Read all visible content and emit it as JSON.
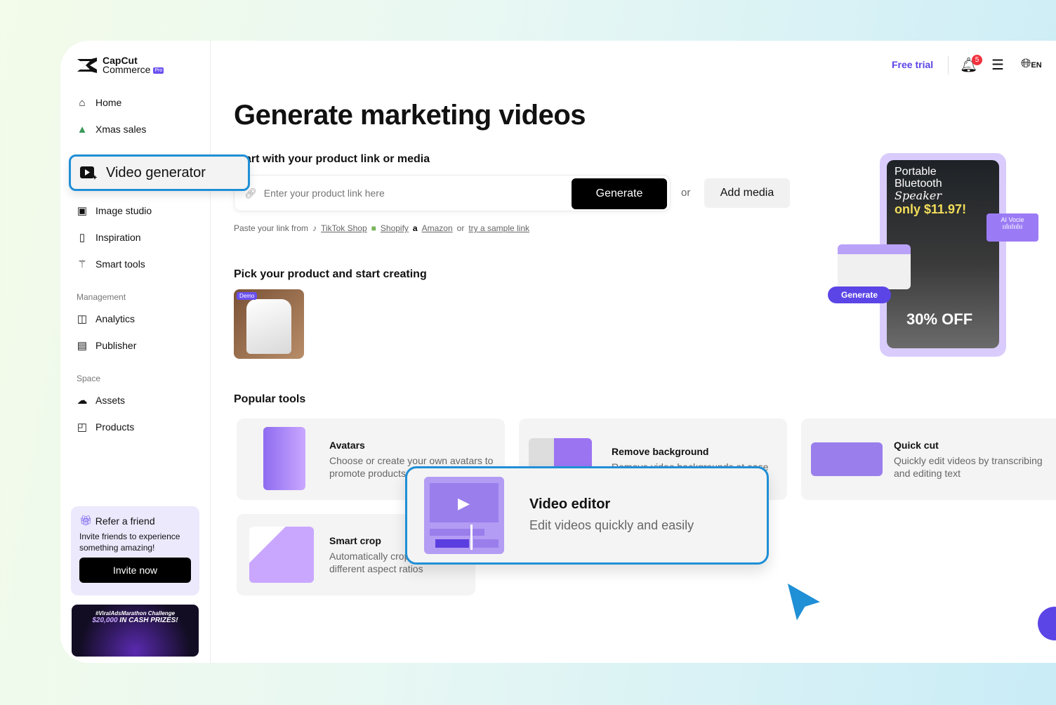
{
  "brand": {
    "name": "CapCut",
    "sub": "Commerce",
    "badge": "Pro"
  },
  "sidebar": {
    "items": [
      {
        "label": "Home",
        "icon": "home-icon"
      },
      {
        "label": "Xmas sales",
        "icon": "tree-icon"
      },
      {
        "label": "Video generator",
        "icon": "video-plus-icon",
        "active": true
      },
      {
        "label": "Image studio",
        "icon": "image-icon"
      },
      {
        "label": "Inspiration",
        "icon": "inspiration-icon"
      },
      {
        "label": "Smart tools",
        "icon": "magic-wand-icon"
      }
    ],
    "management_label": "Management",
    "management": [
      {
        "label": "Analytics"
      },
      {
        "label": "Publisher"
      }
    ],
    "space_label": "Space",
    "space": [
      {
        "label": "Assets"
      },
      {
        "label": "Products"
      }
    ],
    "refer": {
      "title": "Refer a friend",
      "text": "Invite friends to experience something amazing!",
      "button": "Invite now"
    },
    "promo": {
      "line1": "#ViralAdsMarathon Challenge",
      "amount": "$20,000",
      "line2": "IN CASH PRIZES!"
    }
  },
  "topbar": {
    "free_trial": "Free trial",
    "notifications": "5",
    "lang": "EN"
  },
  "main": {
    "title": "Generate marketing videos",
    "start_heading": "Start with your product link or media",
    "link_placeholder": "Enter your product link here",
    "generate": "Generate",
    "or": "or",
    "add_media": "Add media",
    "paste": {
      "prefix": "Paste your link from",
      "tiktok": "TikTok Shop",
      "shopify": "Shopify",
      "amazon": "Amazon",
      "or": "or",
      "sample": "try a sample link"
    },
    "pick_heading": "Pick your product and start creating",
    "demo_badge": "Demo",
    "popular_heading": "Popular tools",
    "tools": [
      {
        "title": "Avatars",
        "desc": "Choose or create your own avatars to promote products"
      },
      {
        "title": "Remove background",
        "desc": "Remove video backgrounds at ease"
      },
      {
        "title": "Quick cut",
        "desc": "Quickly edit videos by transcribing and editing text"
      },
      {
        "title": "Smart crop",
        "desc": "Automatically crop videos for different aspect ratios"
      },
      {
        "title": "Video editor",
        "desc": "Edit videos quickly and easily"
      }
    ]
  },
  "hero": {
    "line1": "Portable",
    "line2": "Bluetooth",
    "line2b": "Speaker",
    "price": "only $11.97!",
    "off": "30% OFF",
    "ai_voice": "AI Vocie",
    "generate": "Generate"
  },
  "colors": {
    "accent": "#5b45e6",
    "highlight": "#1f8fd6"
  }
}
